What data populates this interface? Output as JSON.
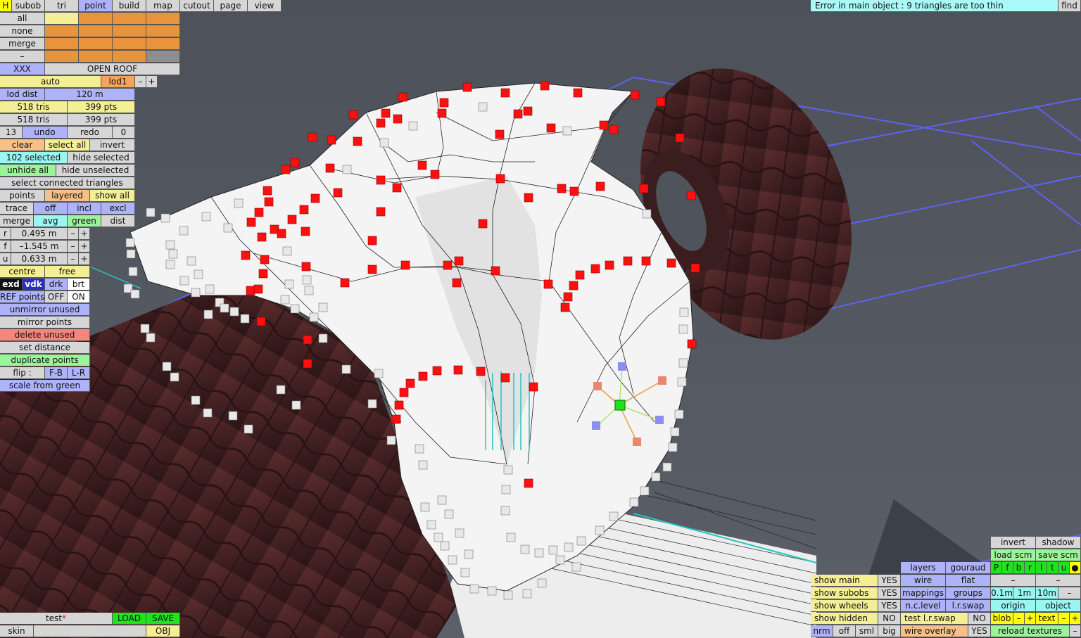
{
  "menu": {
    "h": "H",
    "subob": "subob",
    "tri": "tri",
    "point": "point",
    "build": "build",
    "map": "map",
    "cutout": "cutout",
    "page": "page",
    "view": "view"
  },
  "error_message": "Error in main object : 9 triangles are too thin",
  "find": "find",
  "sel": {
    "all": "all",
    "none": "none",
    "merge": "merge",
    "minus": "–"
  },
  "obj": {
    "xxx": "XXX",
    "name": "OPEN ROOF"
  },
  "lod": {
    "auto": "auto",
    "lod1": "lod1",
    "minus": "–",
    "plus": "+",
    "dist_label": "lod dist",
    "dist_value": "120 m"
  },
  "counts": {
    "tris1": "518 tris",
    "pts1": "399 pts",
    "tris2": "518 tris",
    "pts2": "399 pts"
  },
  "history": {
    "num": "13",
    "undo": "undo",
    "redo": "redo",
    "zero": "0"
  },
  "selection": {
    "clear": "clear",
    "select_all": "select all",
    "invert": "invert",
    "selected": "102 selected",
    "hide_selected": "hide selected",
    "unhide_all": "unhide all",
    "hide_unselected": "hide unselected",
    "select_connected": "select connected triangles"
  },
  "mode": {
    "points": "points",
    "layered": "layered",
    "show_all": "show all",
    "trace": "trace",
    "off": "off",
    "incl": "incl",
    "excl": "excl",
    "merge": "merge",
    "avg": "avg",
    "green": "green",
    "dist": "dist"
  },
  "coords": [
    {
      "axis": "r",
      "value": "0.495 m"
    },
    {
      "axis": "f",
      "value": "–1.545 m"
    },
    {
      "axis": "u",
      "value": "0.633 m"
    }
  ],
  "coord_minus": "–",
  "coord_plus": "+",
  "pivot": {
    "centre": "centre",
    "free": "free"
  },
  "render_mode": {
    "exd": "exd",
    "vdk": "vdk",
    "drk": "drk",
    "brt": "brt"
  },
  "ref_points": {
    "label": "REF points",
    "off": "OFF",
    "on": "ON"
  },
  "tools": {
    "unmirror": "unmirror unused",
    "mirror": "mirror points",
    "delete": "delete unused",
    "set_distance": "set distance",
    "duplicate": "duplicate points",
    "flip": "flip :",
    "fb": "F-B",
    "lr": "L-R",
    "scale": "scale from green"
  },
  "file": {
    "name": "test",
    "modified_mark": "*",
    "load": "LOAD",
    "save": "SAVE",
    "skin": "skin",
    "obj": "OBJ"
  },
  "view_panel": {
    "invert": "invert",
    "shadow": "shadow",
    "load_scm": "load scm",
    "save_scm": "save scm",
    "toggles": [
      "P",
      "f",
      "b",
      "r",
      "l",
      "t",
      "u"
    ],
    "dot": "●",
    "layers": "layers",
    "gouraud": "gouraud",
    "wire": "wire",
    "flat": "flat",
    "mappings": "mappings",
    "groups": "groups",
    "ncl": "n.c.level",
    "lrswap": "l.r.swap",
    "test_lrswap": "test l.r.swap",
    "test_no": "NO",
    "wire_overlay": "wire overlay",
    "wire_yes": "YES",
    "dash1": "–",
    "dash2": "–",
    "grid": [
      "0.1m",
      "1m",
      "10m",
      "–"
    ],
    "origin": "origin",
    "object": "object",
    "blob": "blob",
    "text": "text",
    "minus": "–",
    "plus": "+",
    "reload": "reload textures",
    "show_main": "show main",
    "show_main_v": "YES",
    "show_subobs": "show subobs",
    "show_subobs_v": "YES",
    "show_wheels": "show wheels",
    "show_wheels_v": "YES",
    "show_hidden": "show hidden",
    "show_hidden_v": "NO",
    "nrm": "nrm",
    "off": "off",
    "sml": "sml",
    "big": "big"
  },
  "colors": {
    "background": "#4f535c",
    "grid": "#5c63f0",
    "tyre": "#4a2526",
    "selected_point": "#ff1010",
    "unselected_point": "#e6e6e6",
    "green_point": "#1ee31e"
  }
}
